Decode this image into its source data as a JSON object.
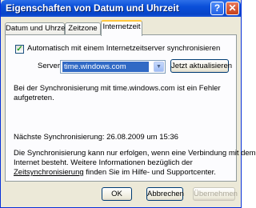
{
  "window": {
    "title": "Eigenschaften von Datum und Uhrzeit",
    "help_glyph": "?",
    "close_glyph": "✕"
  },
  "tabs": [
    {
      "label": "Datum und Uhrzeit"
    },
    {
      "label": "Zeitzone"
    },
    {
      "label": "Internetzeit"
    }
  ],
  "internet_time": {
    "auto_sync_checked": true,
    "auto_sync_label": "Automatisch mit einem Internetzeitserver synchronisieren",
    "server_label": "Server:",
    "server_value": "time.windows.com",
    "update_now_button": "Jetzt aktualisieren",
    "error_line1": "Bei der Synchronisierung mit time.windows.com ist ein Fehler",
    "error_line2": "aufgetreten.",
    "next_sync": "Nächste Synchronisierung: 26.08.2009 um 15:36",
    "info_line1": "Die Synchronisierung kann nur erfolgen, wenn eine Verbindung mit dem",
    "info_line2": "Internet besteht. Weitere Informationen bezüglich der",
    "info_link": "Zeitsynchronisierung",
    "info_line3_rest": " finden Sie im Hilfe- und Supportcenter."
  },
  "buttons": {
    "ok": "OK",
    "cancel": "Abbrechen",
    "apply": "Übernehmen"
  }
}
